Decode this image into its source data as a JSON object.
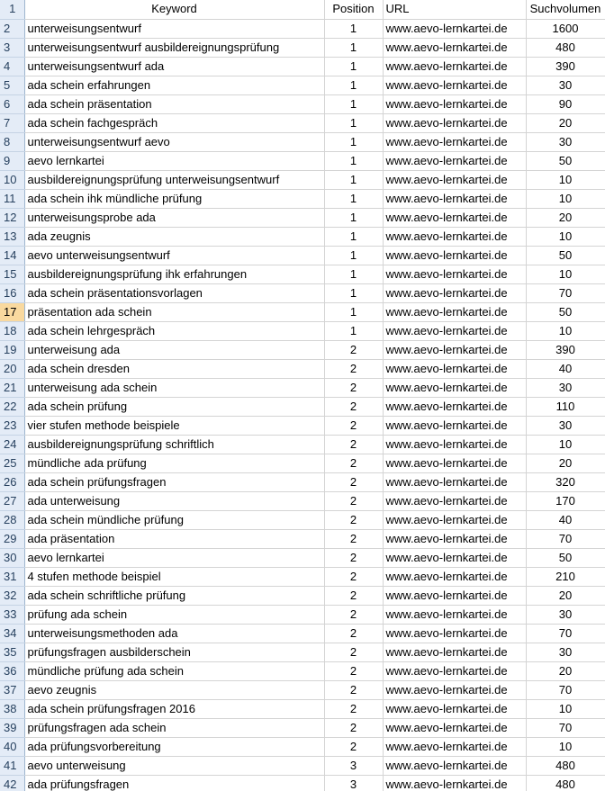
{
  "sheet": {
    "headers": {
      "rownum": "1",
      "keyword": "Keyword",
      "position": "Position",
      "url": "URL",
      "volume": "Suchvolumen"
    },
    "selected_row": "17",
    "rows": [
      {
        "n": "2",
        "keyword": "unterweisungsentwurf",
        "position": "1",
        "url": "www.aevo-lernkartei.de",
        "volume": "1600"
      },
      {
        "n": "3",
        "keyword": "unterweisungsentwurf ausbildereignungsprüfung",
        "position": "1",
        "url": "www.aevo-lernkartei.de",
        "volume": "480"
      },
      {
        "n": "4",
        "keyword": "unterweisungsentwurf ada",
        "position": "1",
        "url": "www.aevo-lernkartei.de",
        "volume": "390"
      },
      {
        "n": "5",
        "keyword": "ada schein erfahrungen",
        "position": "1",
        "url": "www.aevo-lernkartei.de",
        "volume": "30"
      },
      {
        "n": "6",
        "keyword": "ada schein präsentation",
        "position": "1",
        "url": "www.aevo-lernkartei.de",
        "volume": "90"
      },
      {
        "n": "7",
        "keyword": "ada schein fachgespräch",
        "position": "1",
        "url": "www.aevo-lernkartei.de",
        "volume": "20"
      },
      {
        "n": "8",
        "keyword": "unterweisungsentwurf aevo",
        "position": "1",
        "url": "www.aevo-lernkartei.de",
        "volume": "30"
      },
      {
        "n": "9",
        "keyword": "aevo lernkartei",
        "position": "1",
        "url": "www.aevo-lernkartei.de",
        "volume": "50"
      },
      {
        "n": "10",
        "keyword": "ausbildereignungsprüfung unterweisungsentwurf",
        "position": "1",
        "url": "www.aevo-lernkartei.de",
        "volume": "10"
      },
      {
        "n": "11",
        "keyword": "ada schein ihk mündliche prüfung",
        "position": "1",
        "url": "www.aevo-lernkartei.de",
        "volume": "10"
      },
      {
        "n": "12",
        "keyword": "unterweisungsprobe ada",
        "position": "1",
        "url": "www.aevo-lernkartei.de",
        "volume": "20"
      },
      {
        "n": "13",
        "keyword": "ada zeugnis",
        "position": "1",
        "url": "www.aevo-lernkartei.de",
        "volume": "10"
      },
      {
        "n": "14",
        "keyword": "aevo unterweisungsentwurf",
        "position": "1",
        "url": "www.aevo-lernkartei.de",
        "volume": "50"
      },
      {
        "n": "15",
        "keyword": "ausbildereignungsprüfung ihk erfahrungen",
        "position": "1",
        "url": "www.aevo-lernkartei.de",
        "volume": "10"
      },
      {
        "n": "16",
        "keyword": "ada schein präsentationsvorlagen",
        "position": "1",
        "url": "www.aevo-lernkartei.de",
        "volume": "70"
      },
      {
        "n": "17",
        "keyword": "präsentation ada schein",
        "position": "1",
        "url": "www.aevo-lernkartei.de",
        "volume": "50"
      },
      {
        "n": "18",
        "keyword": "ada schein lehrgespräch",
        "position": "1",
        "url": "www.aevo-lernkartei.de",
        "volume": "10"
      },
      {
        "n": "19",
        "keyword": "unterweisung ada",
        "position": "2",
        "url": "www.aevo-lernkartei.de",
        "volume": "390"
      },
      {
        "n": "20",
        "keyword": "ada schein dresden",
        "position": "2",
        "url": "www.aevo-lernkartei.de",
        "volume": "40"
      },
      {
        "n": "21",
        "keyword": "unterweisung ada schein",
        "position": "2",
        "url": "www.aevo-lernkartei.de",
        "volume": "30"
      },
      {
        "n": "22",
        "keyword": "ada schein prüfung",
        "position": "2",
        "url": "www.aevo-lernkartei.de",
        "volume": "110"
      },
      {
        "n": "23",
        "keyword": "vier stufen methode beispiele",
        "position": "2",
        "url": "www.aevo-lernkartei.de",
        "volume": "30"
      },
      {
        "n": "24",
        "keyword": "ausbildereignungsprüfung schriftlich",
        "position": "2",
        "url": "www.aevo-lernkartei.de",
        "volume": "10"
      },
      {
        "n": "25",
        "keyword": "mündliche ada prüfung",
        "position": "2",
        "url": "www.aevo-lernkartei.de",
        "volume": "20"
      },
      {
        "n": "26",
        "keyword": "ada schein prüfungsfragen",
        "position": "2",
        "url": "www.aevo-lernkartei.de",
        "volume": "320"
      },
      {
        "n": "27",
        "keyword": "ada unterweisung",
        "position": "2",
        "url": "www.aevo-lernkartei.de",
        "volume": "170"
      },
      {
        "n": "28",
        "keyword": "ada schein mündliche prüfung",
        "position": "2",
        "url": "www.aevo-lernkartei.de",
        "volume": "40"
      },
      {
        "n": "29",
        "keyword": "ada präsentation",
        "position": "2",
        "url": "www.aevo-lernkartei.de",
        "volume": "70"
      },
      {
        "n": "30",
        "keyword": "aevo lernkartei",
        "position": "2",
        "url": "www.aevo-lernkartei.de",
        "volume": "50"
      },
      {
        "n": "31",
        "keyword": "4 stufen methode beispiel",
        "position": "2",
        "url": "www.aevo-lernkartei.de",
        "volume": "210"
      },
      {
        "n": "32",
        "keyword": "ada schein schriftliche prüfung",
        "position": "2",
        "url": "www.aevo-lernkartei.de",
        "volume": "20"
      },
      {
        "n": "33",
        "keyword": "prüfung ada schein",
        "position": "2",
        "url": "www.aevo-lernkartei.de",
        "volume": "30"
      },
      {
        "n": "34",
        "keyword": "unterweisungsmethoden ada",
        "position": "2",
        "url": "www.aevo-lernkartei.de",
        "volume": "70"
      },
      {
        "n": "35",
        "keyword": "prüfungsfragen ausbilderschein",
        "position": "2",
        "url": "www.aevo-lernkartei.de",
        "volume": "30"
      },
      {
        "n": "36",
        "keyword": "mündliche prüfung ada schein",
        "position": "2",
        "url": "www.aevo-lernkartei.de",
        "volume": "20"
      },
      {
        "n": "37",
        "keyword": "aevo zeugnis",
        "position": "2",
        "url": "www.aevo-lernkartei.de",
        "volume": "70"
      },
      {
        "n": "38",
        "keyword": "ada schein prüfungsfragen 2016",
        "position": "2",
        "url": "www.aevo-lernkartei.de",
        "volume": "10"
      },
      {
        "n": "39",
        "keyword": "prüfungsfragen ada schein",
        "position": "2",
        "url": "www.aevo-lernkartei.de",
        "volume": "70"
      },
      {
        "n": "40",
        "keyword": "ada prüfungsvorbereitung",
        "position": "2",
        "url": "www.aevo-lernkartei.de",
        "volume": "10"
      },
      {
        "n": "41",
        "keyword": "aevo unterweisung",
        "position": "3",
        "url": "www.aevo-lernkartei.de",
        "volume": "480"
      },
      {
        "n": "42",
        "keyword": "ada prüfungsfragen",
        "position": "3",
        "url": "www.aevo-lernkartei.de",
        "volume": "480"
      }
    ]
  }
}
